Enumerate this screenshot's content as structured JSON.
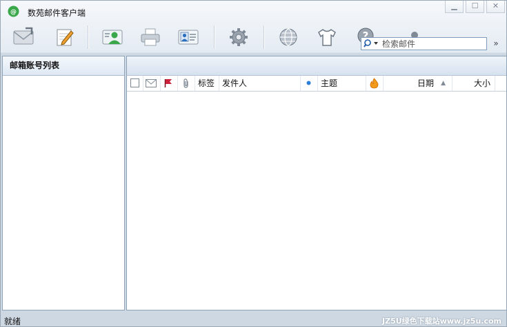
{
  "window": {
    "title": "数苑邮件客户端"
  },
  "toolbar": {
    "buttons": [
      {
        "icon": "receive-mail-icon"
      },
      {
        "icon": "compose-icon"
      },
      {
        "icon": "contacts-icon"
      },
      {
        "icon": "printer-icon"
      },
      {
        "icon": "address-card-icon"
      },
      {
        "icon": "settings-gear-icon"
      },
      {
        "icon": "globe-icon"
      },
      {
        "icon": "tshirt-skin-icon"
      },
      {
        "icon": "help-icon"
      },
      {
        "icon": "user-icon"
      }
    ],
    "search_placeholder": "检索邮件"
  },
  "left_panel": {
    "title": "邮箱账号列表"
  },
  "message_list": {
    "columns": {
      "tag": "标签",
      "sender": "发件人",
      "subject": "主题",
      "date": "日期",
      "size": "大小"
    },
    "rows": []
  },
  "statusbar": {
    "text": "就绪",
    "watermark": "JZ5U绿色下载站www.jz5u.com"
  },
  "colors": {
    "flag": "#cc1f3a",
    "accent_blue": "#2c7ed6",
    "brand_green": "#3aa74a"
  }
}
